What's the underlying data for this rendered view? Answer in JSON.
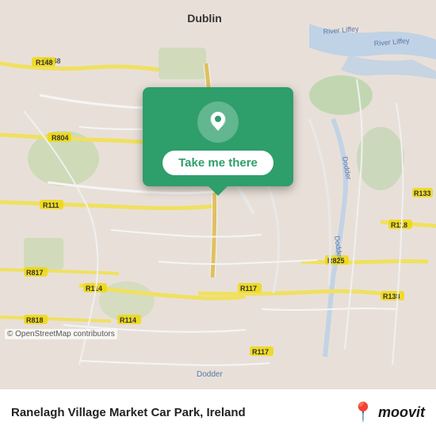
{
  "map": {
    "attribution": "© OpenStreetMap contributors",
    "background_color": "#e8e0d8"
  },
  "popup": {
    "button_label": "Take me there",
    "icon_name": "location-pin-icon",
    "bg_color": "#2e9e6b"
  },
  "bottom_bar": {
    "location_name": "Ranelagh Village Market Car Park, Ireland",
    "logo_text": "moovit",
    "logo_pin_color": "#e8392d"
  }
}
